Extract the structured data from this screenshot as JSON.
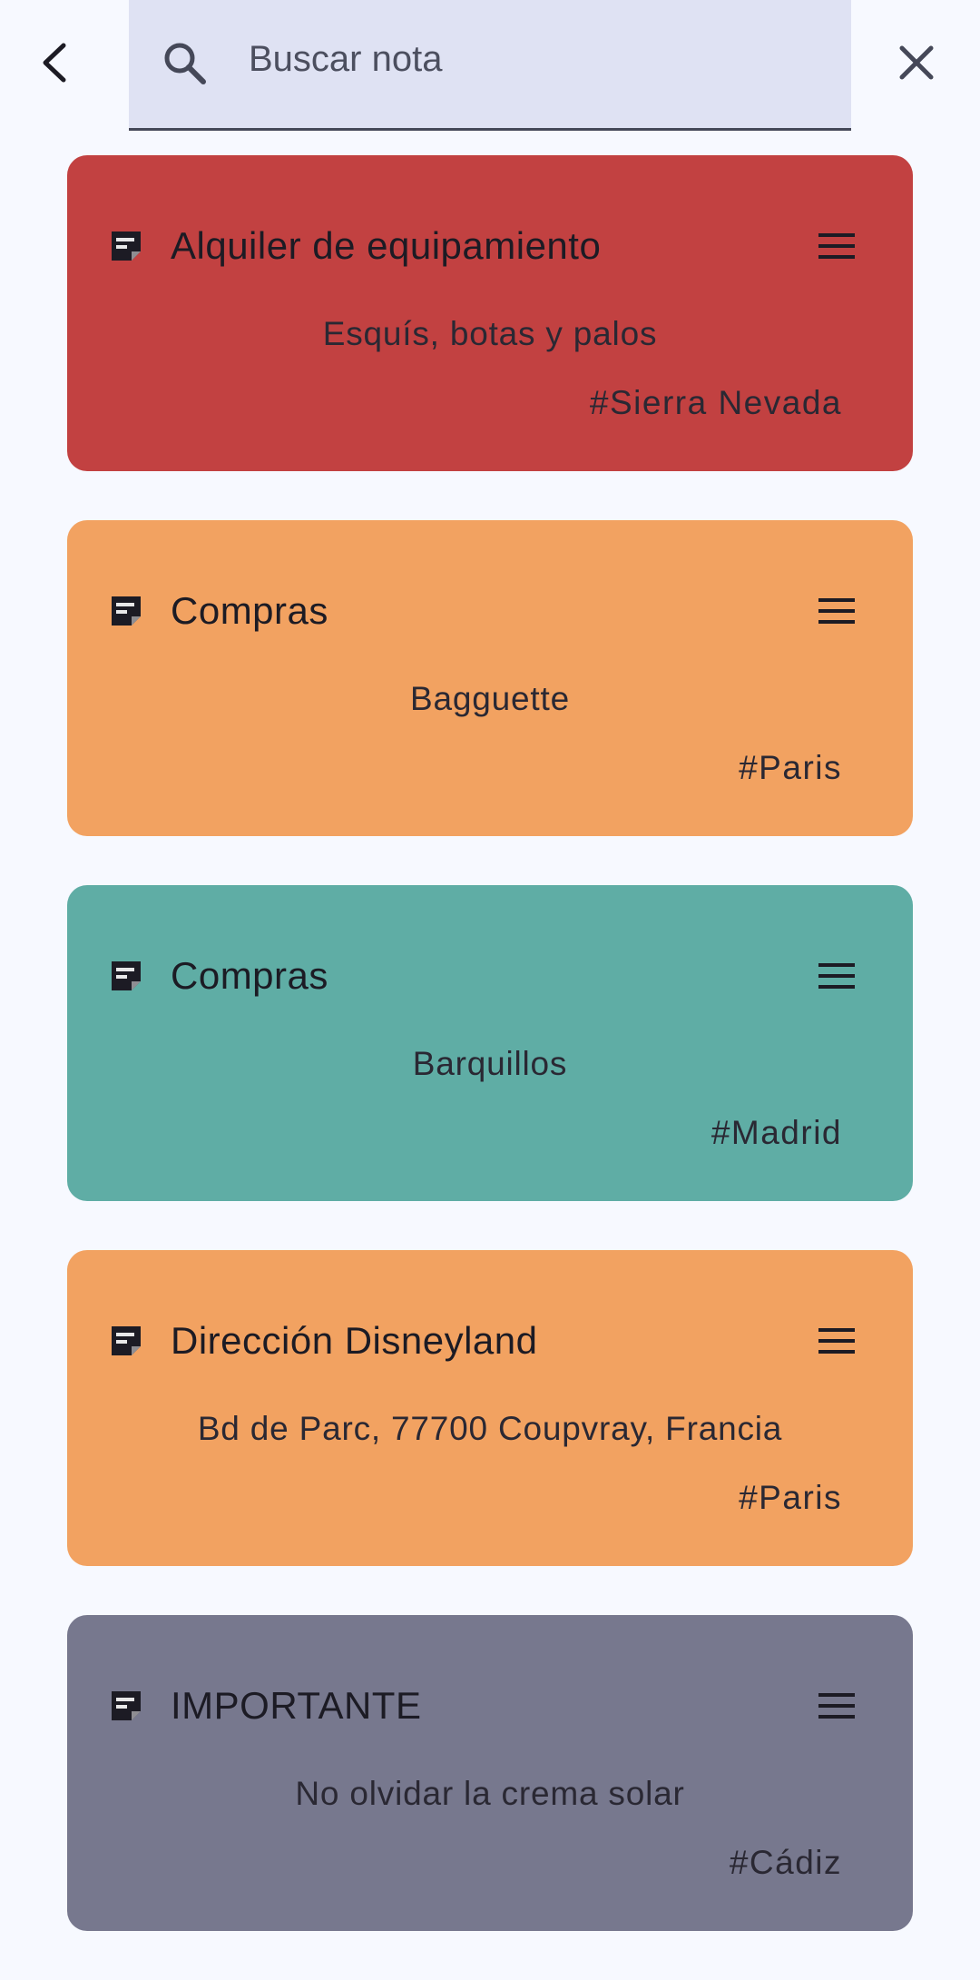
{
  "search": {
    "placeholder": "Buscar nota",
    "value": ""
  },
  "icons": {
    "back": "arrow-back-icon",
    "search": "search-icon",
    "close": "close-icon",
    "note": "sticky-note-icon",
    "menu": "menu-icon"
  },
  "notes": [
    {
      "title": "Alquiler de equipamiento",
      "body": "Esquís, botas y palos",
      "tag": "#Sierra Nevada",
      "color": "#c24141"
    },
    {
      "title": "Compras",
      "body": "Bagguette",
      "tag": "#Paris",
      "color": "#f2a261"
    },
    {
      "title": "Compras",
      "body": "Barquillos",
      "tag": "#Madrid",
      "color": "#5fada5"
    },
    {
      "title": "Dirección Disneyland",
      "body": "Bd de Parc, 77700 Coupvray, Francia",
      "tag": "#Paris",
      "color": "#f2a261"
    },
    {
      "title": "IMPORTANTE",
      "body": "No olvidar la crema solar",
      "tag": "#Cádiz",
      "color": "#77788e"
    }
  ]
}
